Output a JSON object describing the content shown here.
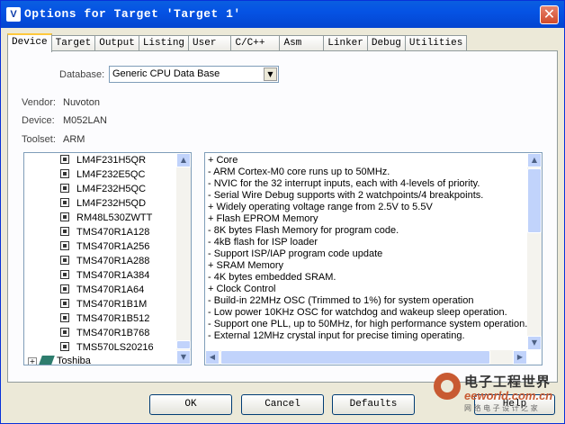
{
  "window": {
    "title": "Options for Target 'Target 1'",
    "icon": "V",
    "close_symbol": "✕"
  },
  "tabs": [
    "Device",
    "Target",
    "Output",
    "Listing",
    "User",
    "C/C++",
    "Asm",
    "Linker",
    "Debug",
    "Utilities"
  ],
  "active_tab": "Device",
  "device": {
    "database_label": "Database:",
    "database_value": "Generic CPU Data Base",
    "vendor_label": "Vendor:",
    "vendor_value": "Nuvoton",
    "device_label": "Device:",
    "device_value": "M052LAN",
    "toolset_label": "Toolset:",
    "toolset_value": "ARM"
  },
  "device_list": [
    "LM4F231H5QR",
    "LM4F232E5QC",
    "LM4F232H5QC",
    "LM4F232H5QD",
    "RM48L530ZWTT",
    "TMS470R1A128",
    "TMS470R1A256",
    "TMS470R1A288",
    "TMS470R1A384",
    "TMS470R1A64",
    "TMS470R1B1M",
    "TMS470R1B512",
    "TMS470R1B768",
    "TMS570LS20216"
  ],
  "vendor_node": "Toshiba",
  "description_lines": [
    "+ Core",
    " - ARM Cortex-M0 core runs up to 50MHz.",
    " - NVIC for the 32 interrupt inputs, each with 4-levels of priority.",
    " - Serial Wire Debug supports with 2 watchpoints/4 breakpoints.",
    "+ Widely operating voltage range from 2.5V to 5.5V",
    "+ Flash EPROM Memory",
    " - 8K bytes Flash Memory for program code.",
    " - 4kB flash for ISP loader",
    " - Support ISP/IAP program code update",
    "+ SRAM Memory",
    " - 4K bytes embedded SRAM.",
    "+ Clock Control",
    " - Build-in 22MHz OSC (Trimmed to 1%) for system operation",
    " - Low power 10KHz OSC for watchdog and wakeup sleep operation.",
    " - Support one PLL, up to 50MHz, for high performance system operation.",
    " - External 12MHz crystal input for precise timing operating."
  ],
  "buttons": {
    "ok": "OK",
    "cancel": "Cancel",
    "defaults": "Defaults",
    "help": "Help"
  },
  "watermark": {
    "cn": "电子工程世界",
    "en": "eeworld.com.cn",
    "sub": "网 络 电 子 设 计 之 家"
  }
}
